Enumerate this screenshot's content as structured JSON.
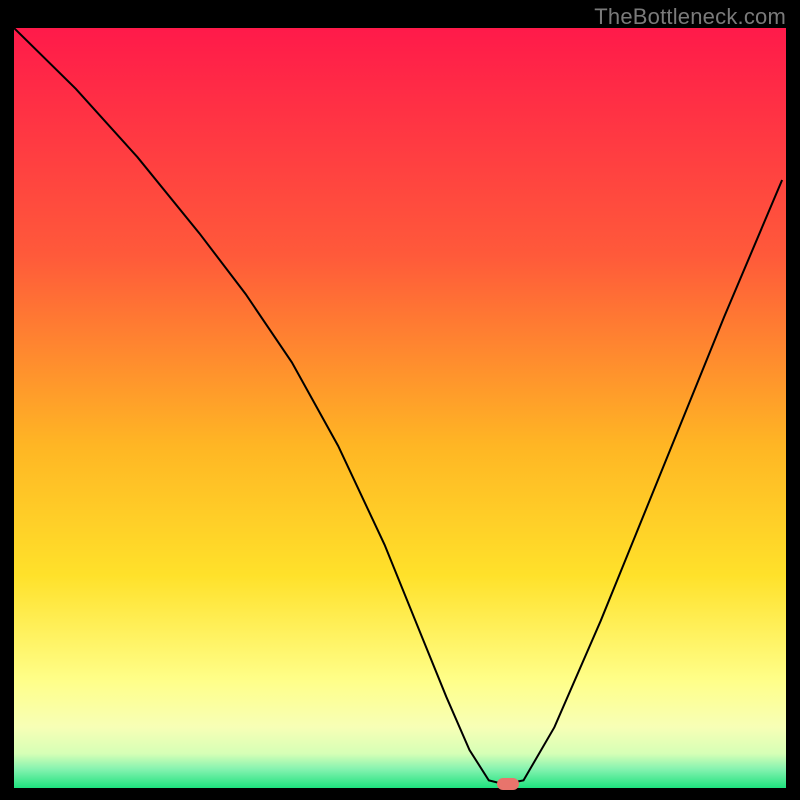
{
  "watermark": "TheBottleneck.com",
  "marker_color": "#e8746c",
  "chart_data": {
    "type": "line",
    "title": "",
    "xlabel": "",
    "ylabel": "",
    "xlim": [
      0,
      100
    ],
    "ylim": [
      0,
      100
    ],
    "grid": false,
    "legend": false,
    "background_gradient_stops": [
      {
        "pos": 0.0,
        "color": "#ff1a4a"
      },
      {
        "pos": 0.3,
        "color": "#ff5a3a"
      },
      {
        "pos": 0.55,
        "color": "#ffb624"
      },
      {
        "pos": 0.72,
        "color": "#ffe12a"
      },
      {
        "pos": 0.86,
        "color": "#ffff8a"
      },
      {
        "pos": 0.92,
        "color": "#f7ffb6"
      },
      {
        "pos": 0.955,
        "color": "#d6ffb6"
      },
      {
        "pos": 0.975,
        "color": "#86f3b0"
      },
      {
        "pos": 1.0,
        "color": "#1ee27e"
      }
    ],
    "series": [
      {
        "name": "bottleneck-curve",
        "color": "#000000",
        "x": [
          0,
          8,
          16,
          24,
          30,
          36,
          42,
          48,
          52,
          56,
          59,
          61.5,
          63.5,
          66,
          70,
          76,
          84,
          92,
          99.5
        ],
        "y": [
          100,
          92,
          83,
          73,
          65,
          56,
          45,
          32,
          22,
          12,
          5,
          1,
          0.5,
          1,
          8,
          22,
          42,
          62,
          80
        ]
      }
    ],
    "marker": {
      "x": 64,
      "y": 0.5
    }
  }
}
